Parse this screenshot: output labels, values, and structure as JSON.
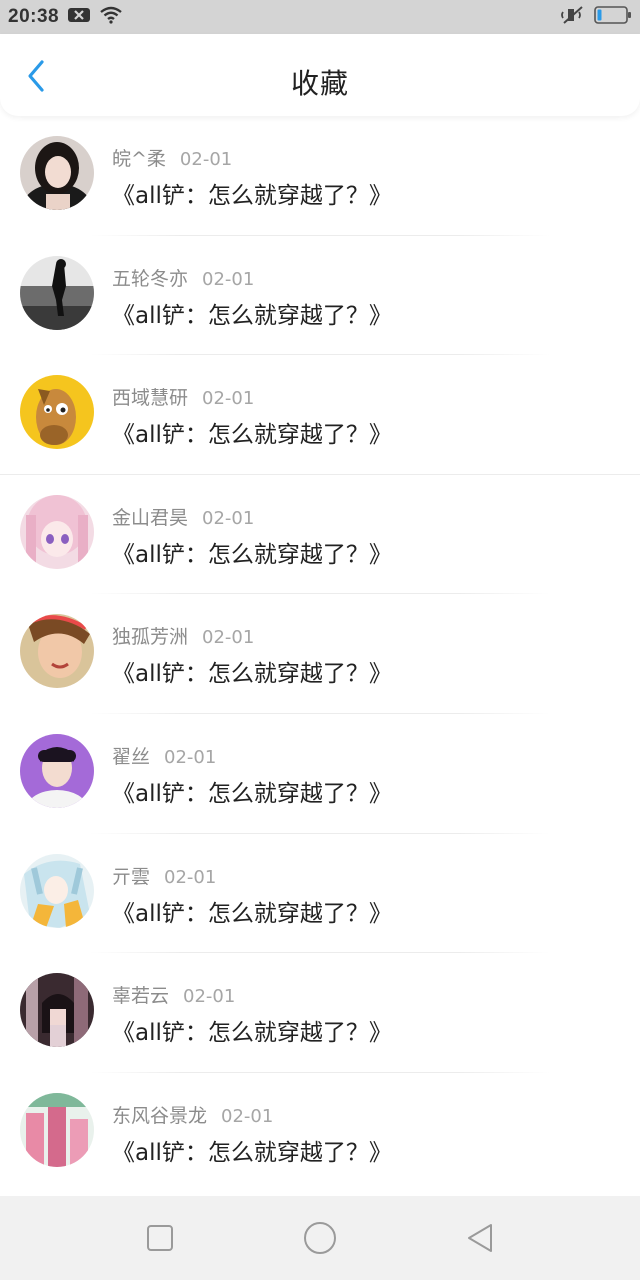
{
  "status_bar": {
    "time": "20:38"
  },
  "header": {
    "title": "收藏"
  },
  "items": [
    {
      "name": "皖^柔",
      "date": "02-01",
      "title": "《all铲：怎么就穿越了？》"
    },
    {
      "name": "五轮冬亦",
      "date": "02-01",
      "title": "《all铲：怎么就穿越了？》"
    },
    {
      "name": "西域慧研",
      "date": "02-01",
      "title": "《all铲：怎么就穿越了？》"
    },
    {
      "name": "金山君昊",
      "date": "02-01",
      "title": "《all铲：怎么就穿越了？》"
    },
    {
      "name": "独孤芳洲",
      "date": "02-01",
      "title": "《all铲：怎么就穿越了？》"
    },
    {
      "name": "翟丝",
      "date": "02-01",
      "title": "《all铲：怎么就穿越了？》"
    },
    {
      "name": "亓雲",
      "date": "02-01",
      "title": "《all铲：怎么就穿越了？》"
    },
    {
      "name": "辜若云",
      "date": "02-01",
      "title": "《all铲：怎么就穿越了？》"
    },
    {
      "name": "东风谷景龙",
      "date": "02-01",
      "title": "《all铲：怎么就穿越了？》"
    }
  ],
  "icons": {
    "back": "chevron-left-icon",
    "recents": "square-icon",
    "home": "circle-icon",
    "back_nav": "triangle-left-icon"
  },
  "colors": {
    "accent": "#2a9ae8",
    "status_bar": "#d4d4d4",
    "nav_bar": "#f1f1f1"
  }
}
